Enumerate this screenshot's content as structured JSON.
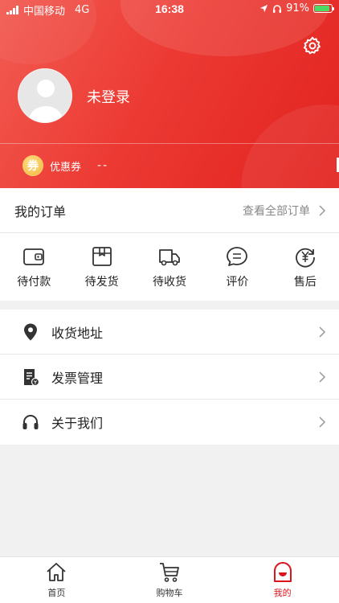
{
  "status_bar": {
    "carrier": "中国移动",
    "network": "4G",
    "time": "16:38",
    "battery": "91%"
  },
  "profile": {
    "login_text": "未登录",
    "coupon_badge": "券",
    "coupon_label": "优惠券",
    "coupon_value": "--"
  },
  "orders": {
    "title": "我的订单",
    "view_all": "查看全部订单",
    "items": [
      {
        "label": "待付款",
        "icon": "wallet-icon"
      },
      {
        "label": "待发货",
        "icon": "box-icon"
      },
      {
        "label": "待收货",
        "icon": "truck-icon"
      },
      {
        "label": "评价",
        "icon": "comment-icon"
      },
      {
        "label": "售后",
        "icon": "refund-icon"
      }
    ]
  },
  "menu": [
    {
      "label": "收货地址",
      "icon": "location-pin-icon"
    },
    {
      "label": "发票管理",
      "icon": "invoice-icon"
    },
    {
      "label": "关于我们",
      "icon": "headset-icon"
    }
  ],
  "tabbar": [
    {
      "label": "首页",
      "icon": "home-icon",
      "active": false
    },
    {
      "label": "购物车",
      "icon": "cart-icon",
      "active": false
    },
    {
      "label": "我的",
      "icon": "profile-icon",
      "active": true
    }
  ],
  "colors": {
    "accent": "#d9141c",
    "header_gradient_start": "#f25c52",
    "header_gradient_end": "#e2221f",
    "background": "#f1f1f1"
  }
}
